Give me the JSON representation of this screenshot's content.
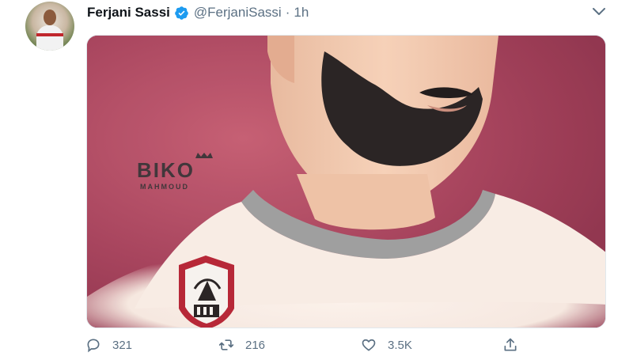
{
  "tweet": {
    "author": {
      "name": "Ferjani Sassi",
      "handle": "@FerjaniSassi",
      "time": "1h",
      "separator": "·"
    },
    "media": {
      "artwork_text": "BIKO",
      "artwork_subtext": "MAHMOUD"
    },
    "actions": {
      "replies": "321",
      "retweets": "216",
      "likes": "3.5K"
    }
  },
  "colors": {
    "background_red": "#a53e58",
    "beard": "#231d1d",
    "skin": "#f3c7aa",
    "shirt": "#f8ece3",
    "collar": "#9c9c9c",
    "badge_red": "#b52030",
    "verified_blue": "#1d9bf0",
    "muted_text": "#5b7083"
  },
  "icons": [
    "avatar",
    "verified-badge-icon",
    "chevron-down-icon",
    "reply-icon",
    "retweet-icon",
    "like-icon",
    "share-icon"
  ]
}
